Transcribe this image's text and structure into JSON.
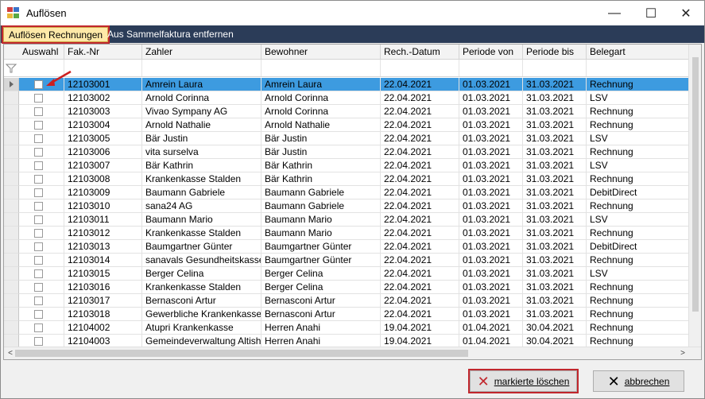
{
  "window": {
    "title": "Auflösen",
    "minimize": "—",
    "maximize": "☐",
    "close": "✕"
  },
  "tabs": [
    {
      "label": "Auflösen Rechnungen"
    },
    {
      "label": "Aus Sammelfaktura entfernen"
    }
  ],
  "columns": [
    "Auswahl",
    "Fak.-Nr",
    "Zahler",
    "Bewohner",
    "Rech.-Datum",
    "Periode von",
    "Periode bis",
    "Belegart"
  ],
  "rows": [
    [
      "12103001",
      "Amrein Laura",
      "Amrein Laura",
      "22.04.2021",
      "01.03.2021",
      "31.03.2021",
      "Rechnung"
    ],
    [
      "12103002",
      "Arnold Corinna",
      "Arnold Corinna",
      "22.04.2021",
      "01.03.2021",
      "31.03.2021",
      "LSV"
    ],
    [
      "12103003",
      "Vivao Sympany AG",
      "Arnold Corinna",
      "22.04.2021",
      "01.03.2021",
      "31.03.2021",
      "Rechnung"
    ],
    [
      "12103004",
      "Arnold Nathalie",
      "Arnold Nathalie",
      "22.04.2021",
      "01.03.2021",
      "31.03.2021",
      "Rechnung"
    ],
    [
      "12103005",
      "Bär Justin",
      "Bär Justin",
      "22.04.2021",
      "01.03.2021",
      "31.03.2021",
      "LSV"
    ],
    [
      "12103006",
      "vita surselva",
      "Bär Justin",
      "22.04.2021",
      "01.03.2021",
      "31.03.2021",
      "Rechnung"
    ],
    [
      "12103007",
      "Bär Kathrin",
      "Bär Kathrin",
      "22.04.2021",
      "01.03.2021",
      "31.03.2021",
      "LSV"
    ],
    [
      "12103008",
      "Krankenkasse Stalden",
      "Bär Kathrin",
      "22.04.2021",
      "01.03.2021",
      "31.03.2021",
      "Rechnung"
    ],
    [
      "12103009",
      "Baumann Gabriele",
      "Baumann Gabriele",
      "22.04.2021",
      "01.03.2021",
      "31.03.2021",
      "DebitDirect"
    ],
    [
      "12103010",
      "sana24 AG",
      "Baumann Gabriele",
      "22.04.2021",
      "01.03.2021",
      "31.03.2021",
      "Rechnung"
    ],
    [
      "12103011",
      "Baumann Mario",
      "Baumann Mario",
      "22.04.2021",
      "01.03.2021",
      "31.03.2021",
      "LSV"
    ],
    [
      "12103012",
      "Krankenkasse Stalden",
      "Baumann Mario",
      "22.04.2021",
      "01.03.2021",
      "31.03.2021",
      "Rechnung"
    ],
    [
      "12103013",
      "Baumgartner Günter",
      "Baumgartner Günter",
      "22.04.2021",
      "01.03.2021",
      "31.03.2021",
      "DebitDirect"
    ],
    [
      "12103014",
      "sanavals Gesundheitskasse",
      "Baumgartner Günter",
      "22.04.2021",
      "01.03.2021",
      "31.03.2021",
      "Rechnung"
    ],
    [
      "12103015",
      "Berger Celina",
      "Berger Celina",
      "22.04.2021",
      "01.03.2021",
      "31.03.2021",
      "LSV"
    ],
    [
      "12103016",
      "Krankenkasse Stalden",
      "Berger Celina",
      "22.04.2021",
      "01.03.2021",
      "31.03.2021",
      "Rechnung"
    ],
    [
      "12103017",
      "Bernasconi Artur",
      "Bernasconi Artur",
      "22.04.2021",
      "01.03.2021",
      "31.03.2021",
      "Rechnung"
    ],
    [
      "12103018",
      "Gewerbliche Krankenkasse",
      "Bernasconi Artur",
      "22.04.2021",
      "01.03.2021",
      "31.03.2021",
      "Rechnung"
    ],
    [
      "12104002",
      "Atupri Krankenkasse",
      "Herren Anahi",
      "19.04.2021",
      "01.04.2021",
      "30.04.2021",
      "Rechnung"
    ],
    [
      "12104003",
      "Gemeindeverwaltung Altish...",
      "Herren Anahi",
      "19.04.2021",
      "01.04.2021",
      "30.04.2021",
      "Rechnung"
    ]
  ],
  "selected_row_index": 0,
  "buttons": {
    "delete_marked": "markierte löschen",
    "cancel": "abbrechen"
  },
  "colors": {
    "selection": "#3d9be0",
    "tabbar": "#2b3c58",
    "highlight": "#c1272d"
  }
}
